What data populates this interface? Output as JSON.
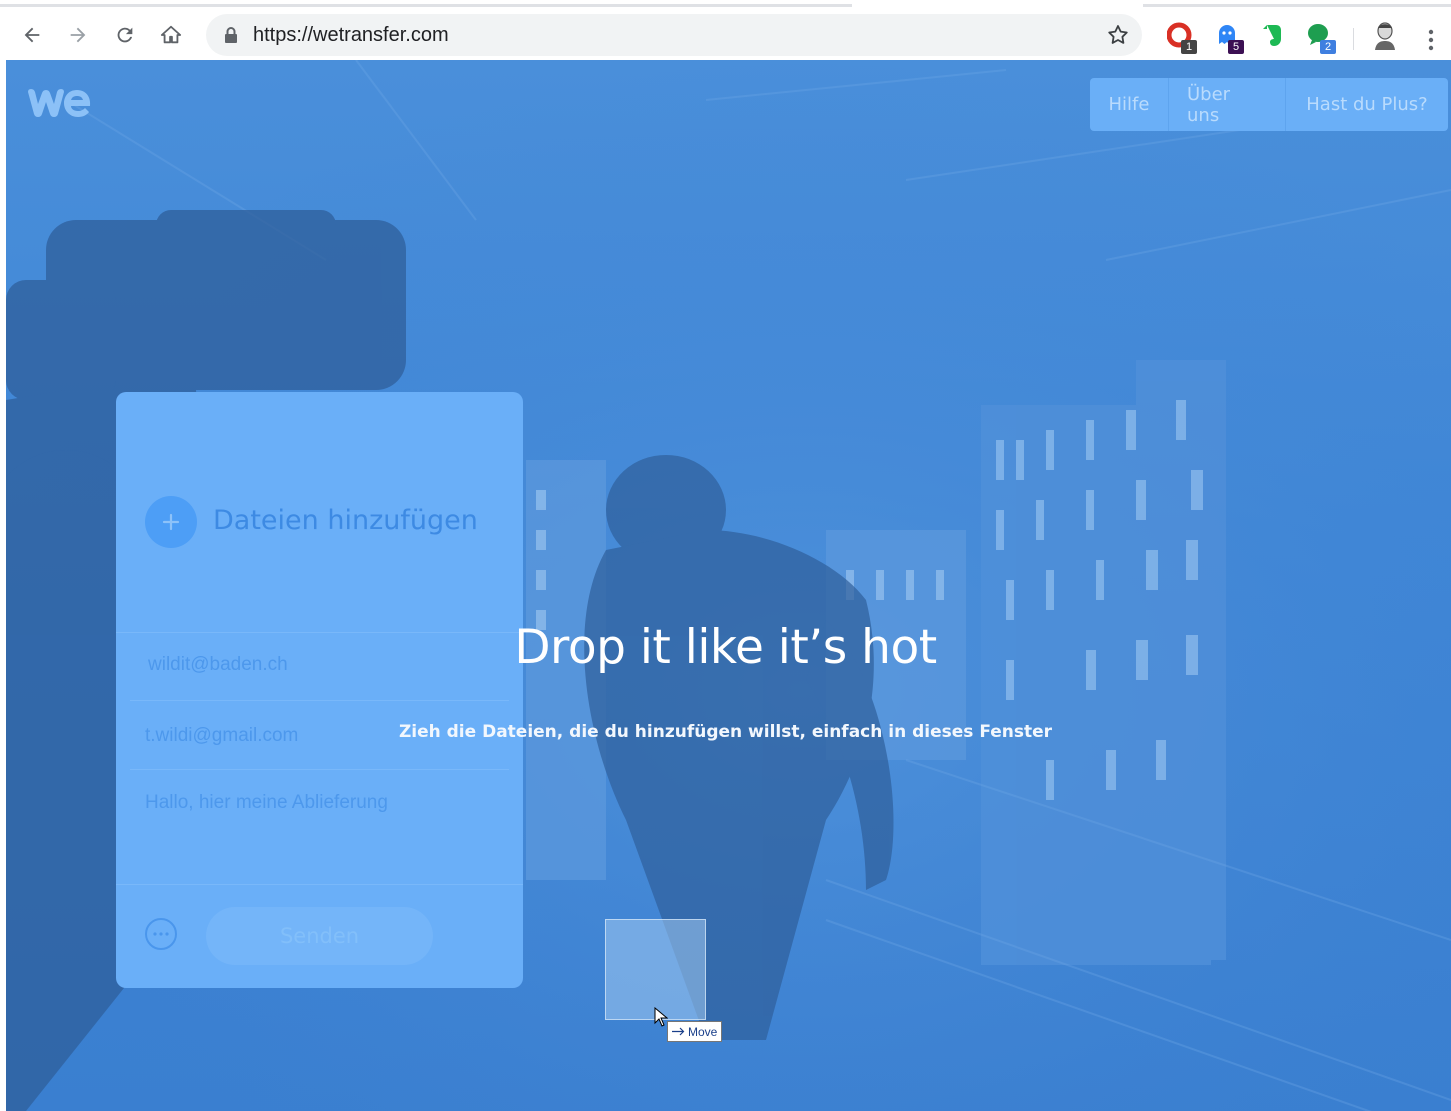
{
  "browser": {
    "url": "https://wetransfer.com",
    "extensions": [
      {
        "name": "opera-extension",
        "badge": "1",
        "color": "#d93025",
        "badge_color": "#444444"
      },
      {
        "name": "ghost-extension",
        "badge": "5",
        "color": "#2f86f6",
        "badge_color": "#3c1053"
      },
      {
        "name": "evernote-extension",
        "badge": "",
        "color": "#1db954"
      },
      {
        "name": "chat-extension",
        "badge": "2",
        "color": "#1e9e50",
        "badge_color": "#3f7fe0"
      }
    ]
  },
  "page": {
    "logo": "we",
    "nav": {
      "help": "Hilfe",
      "about": "Über uns",
      "plus": "Hast du Plus?"
    },
    "panel": {
      "add_files": "Dateien hinzufügen",
      "recipient_email": "wildit@baden.ch",
      "sender_email": "t.wildi@gmail.com",
      "message": "Hallo, hier meine Ablieferung",
      "send_label": "Senden"
    },
    "drop": {
      "title": "Drop it like it’s hot",
      "subtitle": "Zieh die Dateien, die du hinzufügen willst, einfach in dieses Fenster"
    },
    "drag_tooltip": "Move"
  },
  "colors": {
    "background": "#3f86d6",
    "panel": "#6aaff8",
    "accent": "#4d9ef6"
  }
}
